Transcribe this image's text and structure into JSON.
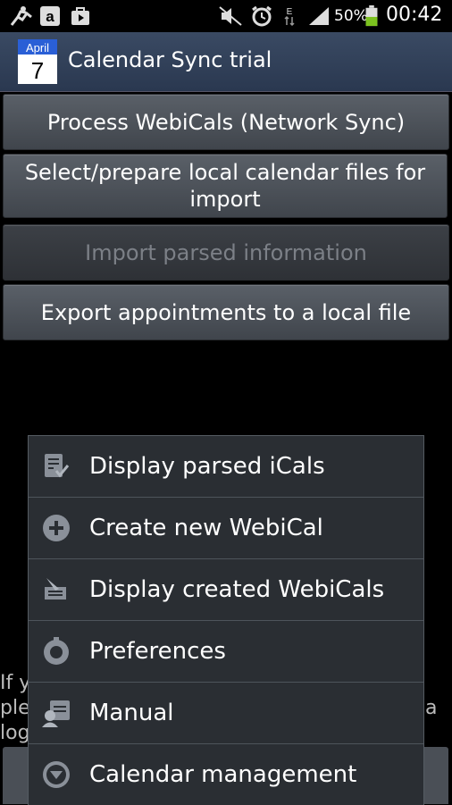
{
  "status_bar": {
    "battery_percent": "50%",
    "time": "00:42"
  },
  "action_bar": {
    "title": "Calendar Sync trial",
    "calendar_month": "April",
    "calendar_day": "7"
  },
  "buttons": {
    "process": "Process WebiCals (Network Sync)",
    "select_prepare": "Select/prepare local calendar files for import",
    "import": "Import parsed information",
    "export": "Export appointments to a local file"
  },
  "background_text": {
    "line1": "If y",
    "line2": "ple",
    "line3": "log",
    "line2_right": "a"
  },
  "menu": {
    "items": [
      {
        "label": "Display parsed iCals",
        "icon": "checklist-icon"
      },
      {
        "label": "Create new WebiCal",
        "icon": "add-icon"
      },
      {
        "label": "Display created WebiCals",
        "icon": "edit-list-icon"
      },
      {
        "label": "Preferences",
        "icon": "settings-icon"
      },
      {
        "label": "Manual",
        "icon": "manual-icon"
      },
      {
        "label": "Calendar management",
        "icon": "dropdown-circle-icon"
      }
    ]
  }
}
